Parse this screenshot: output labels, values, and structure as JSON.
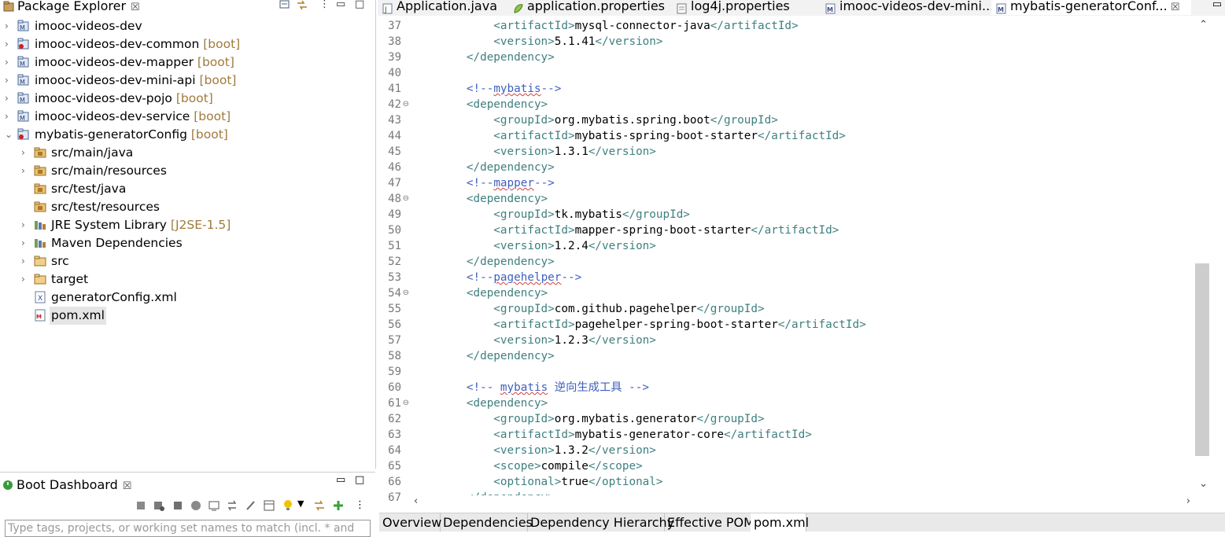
{
  "package_explorer": {
    "title": "Package Explorer",
    "close_glyph": "☒",
    "tree": [
      {
        "label": "imooc-videos-dev",
        "deco": "",
        "level": 0,
        "expander": "›",
        "icon": "maven-project-icon"
      },
      {
        "label": "imooc-videos-dev-common",
        "deco": "[boot]",
        "level": 0,
        "expander": "›",
        "icon": "boot-project-icon"
      },
      {
        "label": "imooc-videos-dev-mapper",
        "deco": "[boot]",
        "level": 0,
        "expander": "›",
        "icon": "maven-project-icon"
      },
      {
        "label": "imooc-videos-dev-mini-api",
        "deco": "[boot]",
        "level": 0,
        "expander": "›",
        "icon": "maven-project-icon"
      },
      {
        "label": "imooc-videos-dev-pojo",
        "deco": "[boot]",
        "level": 0,
        "expander": "›",
        "icon": "maven-project-icon"
      },
      {
        "label": "imooc-videos-dev-service",
        "deco": "[boot]",
        "level": 0,
        "expander": "›",
        "icon": "maven-project-icon"
      },
      {
        "label": "mybatis-generatorConfig",
        "deco": "[boot]",
        "level": 0,
        "expander": "⌄",
        "icon": "boot-project-icon"
      },
      {
        "label": "src/main/java",
        "deco": "",
        "level": 1,
        "expander": "›",
        "icon": "source-folder-icon"
      },
      {
        "label": "src/main/resources",
        "deco": "",
        "level": 1,
        "expander": "›",
        "icon": "source-folder-icon"
      },
      {
        "label": "src/test/java",
        "deco": "",
        "level": 1,
        "expander": "",
        "icon": "source-folder-icon"
      },
      {
        "label": "src/test/resources",
        "deco": "",
        "level": 1,
        "expander": "",
        "icon": "source-folder-icon"
      },
      {
        "label": "JRE System Library",
        "deco": "[J2SE-1.5]",
        "level": 1,
        "expander": "›",
        "icon": "library-icon"
      },
      {
        "label": "Maven Dependencies",
        "deco": "",
        "level": 1,
        "expander": "›",
        "icon": "library-icon"
      },
      {
        "label": "src",
        "deco": "",
        "level": 1,
        "expander": "›",
        "icon": "folder-icon"
      },
      {
        "label": "target",
        "deco": "",
        "level": 1,
        "expander": "›",
        "icon": "folder-icon"
      },
      {
        "label": "generatorConfig.xml",
        "deco": "",
        "level": 1,
        "expander": "",
        "icon": "xml-file-icon"
      },
      {
        "label": "pom.xml",
        "deco": "",
        "level": 1,
        "expander": "",
        "icon": "pom-file-icon",
        "selected": true
      }
    ]
  },
  "boot_dashboard": {
    "title": "Boot Dashboard",
    "close_glyph": "☒",
    "filter_placeholder": "Type tags, projects, or working set names to match (incl. * and"
  },
  "editor_tabs": [
    {
      "label": "Application.java",
      "icon": "java-file-icon"
    },
    {
      "label": "application.properties",
      "icon": "properties-file-icon"
    },
    {
      "label": "log4j.properties",
      "icon": "text-file-icon"
    },
    {
      "label": "imooc-videos-dev-mini...",
      "icon": "maven-pom-icon"
    },
    {
      "label": "mybatis-generatorConf...",
      "icon": "maven-pom-icon",
      "active": true
    }
  ],
  "editor": {
    "lines": [
      {
        "n": "37",
        "fold": "",
        "segs": [
          [
            "            ",
            "txt"
          ],
          [
            "<artifactId>",
            "tag"
          ],
          [
            "mysql-connector-java",
            "txt"
          ],
          [
            "</artifactId>",
            "tag"
          ]
        ]
      },
      {
        "n": "38",
        "fold": "",
        "segs": [
          [
            "            ",
            "txt"
          ],
          [
            "<version>",
            "tag"
          ],
          [
            "5.1.41",
            "txt"
          ],
          [
            "</version>",
            "tag"
          ]
        ]
      },
      {
        "n": "39",
        "fold": "",
        "segs": [
          [
            "        ",
            "txt"
          ],
          [
            "</dependency>",
            "tag"
          ]
        ]
      },
      {
        "n": "40",
        "fold": "",
        "segs": []
      },
      {
        "n": "41",
        "fold": "",
        "segs": [
          [
            "        ",
            "txt"
          ],
          [
            "<!--",
            "cm"
          ],
          [
            "mybatis",
            "cm sq"
          ],
          [
            "-->",
            "cm"
          ]
        ]
      },
      {
        "n": "42",
        "fold": "⊖",
        "segs": [
          [
            "        ",
            "txt"
          ],
          [
            "<dependency>",
            "tag"
          ]
        ]
      },
      {
        "n": "43",
        "fold": "",
        "segs": [
          [
            "            ",
            "txt"
          ],
          [
            "<groupId>",
            "tag"
          ],
          [
            "org.mybatis.spring.boot",
            "txt"
          ],
          [
            "</groupId>",
            "tag"
          ]
        ]
      },
      {
        "n": "44",
        "fold": "",
        "segs": [
          [
            "            ",
            "txt"
          ],
          [
            "<artifactId>",
            "tag"
          ],
          [
            "mybatis-spring-boot-starter",
            "txt"
          ],
          [
            "</artifactId>",
            "tag"
          ]
        ]
      },
      {
        "n": "45",
        "fold": "",
        "segs": [
          [
            "            ",
            "txt"
          ],
          [
            "<version>",
            "tag"
          ],
          [
            "1.3.1",
            "txt"
          ],
          [
            "</version>",
            "tag"
          ]
        ]
      },
      {
        "n": "46",
        "fold": "",
        "segs": [
          [
            "        ",
            "txt"
          ],
          [
            "</dependency>",
            "tag"
          ]
        ]
      },
      {
        "n": "47",
        "fold": "",
        "segs": [
          [
            "        ",
            "txt"
          ],
          [
            "<!--",
            "cm"
          ],
          [
            "mapper",
            "cm sq"
          ],
          [
            "-->",
            "cm"
          ]
        ]
      },
      {
        "n": "48",
        "fold": "⊖",
        "segs": [
          [
            "        ",
            "txt"
          ],
          [
            "<dependency>",
            "tag"
          ]
        ]
      },
      {
        "n": "49",
        "fold": "",
        "segs": [
          [
            "            ",
            "txt"
          ],
          [
            "<groupId>",
            "tag"
          ],
          [
            "tk.mybatis",
            "txt"
          ],
          [
            "</groupId>",
            "tag"
          ]
        ]
      },
      {
        "n": "50",
        "fold": "",
        "segs": [
          [
            "            ",
            "txt"
          ],
          [
            "<artifactId>",
            "tag"
          ],
          [
            "mapper-spring-boot-starter",
            "txt"
          ],
          [
            "</artifactId>",
            "tag"
          ]
        ]
      },
      {
        "n": "51",
        "fold": "",
        "segs": [
          [
            "            ",
            "txt"
          ],
          [
            "<version>",
            "tag"
          ],
          [
            "1.2.4",
            "txt"
          ],
          [
            "</version>",
            "tag"
          ]
        ]
      },
      {
        "n": "52",
        "fold": "",
        "segs": [
          [
            "        ",
            "txt"
          ],
          [
            "</dependency>",
            "tag"
          ]
        ]
      },
      {
        "n": "53",
        "fold": "",
        "segs": [
          [
            "        ",
            "txt"
          ],
          [
            "<!--",
            "cm"
          ],
          [
            "pagehelper",
            "cm sq"
          ],
          [
            "-->",
            "cm"
          ]
        ]
      },
      {
        "n": "54",
        "fold": "⊖",
        "segs": [
          [
            "        ",
            "txt"
          ],
          [
            "<dependency>",
            "tag"
          ]
        ]
      },
      {
        "n": "55",
        "fold": "",
        "segs": [
          [
            "            ",
            "txt"
          ],
          [
            "<groupId>",
            "tag"
          ],
          [
            "com.github.pagehelper",
            "txt"
          ],
          [
            "</groupId>",
            "tag"
          ]
        ]
      },
      {
        "n": "56",
        "fold": "",
        "segs": [
          [
            "            ",
            "txt"
          ],
          [
            "<artifactId>",
            "tag"
          ],
          [
            "pagehelper-spring-boot-starter",
            "txt"
          ],
          [
            "</artifactId>",
            "tag"
          ]
        ]
      },
      {
        "n": "57",
        "fold": "",
        "segs": [
          [
            "            ",
            "txt"
          ],
          [
            "<version>",
            "tag"
          ],
          [
            "1.2.3",
            "txt"
          ],
          [
            "</version>",
            "tag"
          ]
        ]
      },
      {
        "n": "58",
        "fold": "",
        "segs": [
          [
            "        ",
            "txt"
          ],
          [
            "</dependency>",
            "tag"
          ]
        ]
      },
      {
        "n": "59",
        "fold": "",
        "segs": []
      },
      {
        "n": "60",
        "fold": "",
        "segs": [
          [
            "        ",
            "txt"
          ],
          [
            "<!-- ",
            "cm"
          ],
          [
            "mybatis",
            "cm sq"
          ],
          [
            " 逆向生成工具 -->",
            "cm"
          ]
        ]
      },
      {
        "n": "61",
        "fold": "⊖",
        "segs": [
          [
            "        ",
            "txt"
          ],
          [
            "<dependency>",
            "tag"
          ]
        ]
      },
      {
        "n": "62",
        "fold": "",
        "segs": [
          [
            "            ",
            "txt"
          ],
          [
            "<groupId>",
            "tag"
          ],
          [
            "org.mybatis.generator",
            "txt"
          ],
          [
            "</groupId>",
            "tag"
          ]
        ]
      },
      {
        "n": "63",
        "fold": "",
        "segs": [
          [
            "            ",
            "txt"
          ],
          [
            "<artifactId>",
            "tag"
          ],
          [
            "mybatis-generator-core",
            "txt"
          ],
          [
            "</artifactId>",
            "tag"
          ]
        ]
      },
      {
        "n": "64",
        "fold": "",
        "segs": [
          [
            "            ",
            "txt"
          ],
          [
            "<version>",
            "tag"
          ],
          [
            "1.3.2",
            "txt"
          ],
          [
            "</version>",
            "tag"
          ]
        ]
      },
      {
        "n": "65",
        "fold": "",
        "segs": [
          [
            "            ",
            "txt"
          ],
          [
            "<scope>",
            "tag"
          ],
          [
            "compile",
            "txt"
          ],
          [
            "</scope>",
            "tag"
          ]
        ]
      },
      {
        "n": "66",
        "fold": "",
        "segs": [
          [
            "            ",
            "txt"
          ],
          [
            "<optional>",
            "tag"
          ],
          [
            "true",
            "txt"
          ],
          [
            "</optional>",
            "tag"
          ]
        ]
      },
      {
        "n": "67",
        "fold": "",
        "segs": [
          [
            "        ",
            "txt"
          ],
          [
            "</dependency>",
            "tag"
          ]
        ]
      }
    ]
  },
  "bottom_tabs": [
    {
      "label": "Overview"
    },
    {
      "label": "Dependencies"
    },
    {
      "label": "Dependency Hierarchy"
    },
    {
      "label": "Effective POM"
    },
    {
      "label": "pom.xml",
      "active": true
    }
  ],
  "colors": {
    "xml_tag": "#3f7f7f",
    "xml_comment": "#3f5fbf",
    "deco_text": "#a07a3c",
    "selection": "#e5e5e5"
  },
  "glyphs": {
    "minimize": "▭",
    "maximize": "□",
    "scroll_up": "⌃",
    "scroll_down": "⌄",
    "scroll_left": "‹",
    "scroll_right": "›",
    "view_menu": "⋮"
  }
}
